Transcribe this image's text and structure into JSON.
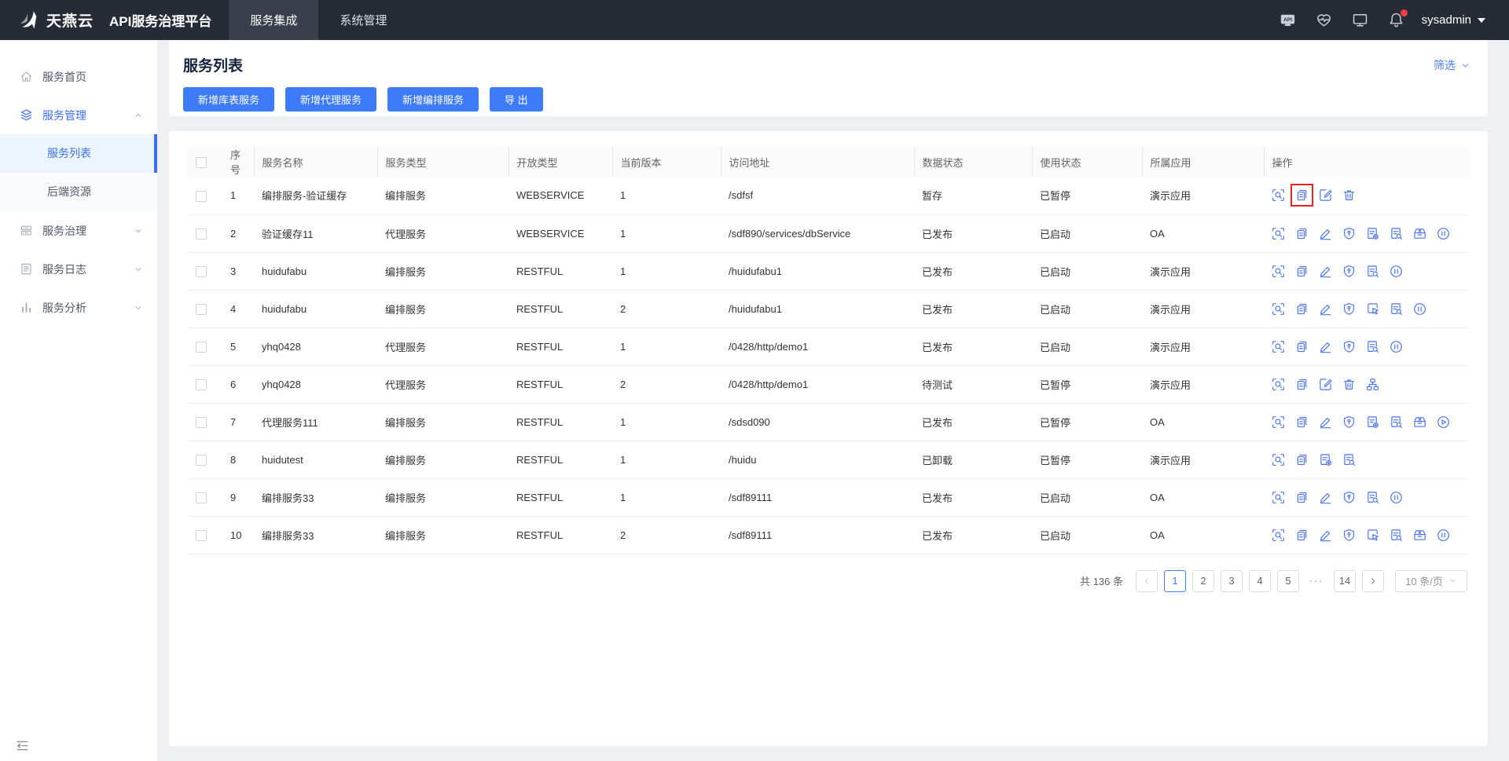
{
  "colors": {
    "accent": "#3e7bfa",
    "topbar_bg": "#272b35",
    "highlight_red": "#e8221c",
    "sidebar_active_bg": "#ecf4fe"
  },
  "topbar": {
    "logo_icon": "logo-icon",
    "brand": "天燕云",
    "product": "API服务治理平台",
    "tabs": [
      {
        "label": "服务集成",
        "active": true
      },
      {
        "label": "系统管理",
        "active": false
      }
    ],
    "icons": [
      {
        "name": "api-badge-icon"
      },
      {
        "name": "health-icon"
      },
      {
        "name": "monitor-icon"
      },
      {
        "name": "bell-icon",
        "badge": true
      }
    ],
    "user": "sysadmin"
  },
  "sidebar": {
    "items": [
      {
        "label": "服务首页",
        "icon": "home-icon"
      },
      {
        "label": "服务管理",
        "icon": "layers-icon",
        "active": true,
        "expanded": true,
        "children": [
          {
            "label": "服务列表",
            "selected": true
          },
          {
            "label": "后端资源",
            "selected": false
          }
        ]
      },
      {
        "label": "服务治理",
        "icon": "govern-icon",
        "collapsible": true
      },
      {
        "label": "服务日志",
        "icon": "log-icon",
        "collapsible": true
      },
      {
        "label": "服务分析",
        "icon": "chart-icon",
        "collapsible": true
      }
    ],
    "collapse_icon": "collapse-menu-icon"
  },
  "page": {
    "title": "服务列表",
    "filter_label": "筛选",
    "buttons": [
      {
        "label": "新增库表服务"
      },
      {
        "label": "新增代理服务"
      },
      {
        "label": "新增编排服务"
      },
      {
        "label": "导 出"
      }
    ]
  },
  "table": {
    "columns": [
      "",
      "序号",
      "服务名称",
      "服务类型",
      "开放类型",
      "当前版本",
      "访问地址",
      "数据状态",
      "使用状态",
      "所属应用",
      "操作"
    ],
    "rows": [
      {
        "index": "1",
        "name": "编排服务-验证缓存",
        "type": "编排服务",
        "open_type": "WEBSERVICE",
        "version": "1",
        "address": "/sdfsf",
        "data_status": "暂存",
        "use_status": "已暂停",
        "app": "演示应用",
        "ops": [
          {
            "icon": "view-icon"
          },
          {
            "icon": "copy-icon",
            "highlight": true
          },
          {
            "icon": "edit-square-icon"
          },
          {
            "icon": "trash-icon"
          }
        ]
      },
      {
        "index": "2",
        "name": "验证缓存11",
        "type": "代理服务",
        "open_type": "WEBSERVICE",
        "version": "1",
        "address": "/sdf890/services/dbService",
        "data_status": "已发布",
        "use_status": "已启动",
        "app": "OA",
        "ops": [
          {
            "icon": "view-icon"
          },
          {
            "icon": "copy-icon"
          },
          {
            "icon": "pencil-icon"
          },
          {
            "icon": "shield-icon"
          },
          {
            "icon": "doc-plus-icon"
          },
          {
            "icon": "doc-search-icon"
          },
          {
            "icon": "box-x-icon"
          },
          {
            "icon": "pause-icon"
          }
        ]
      },
      {
        "index": "3",
        "name": "huidufabu",
        "type": "编排服务",
        "open_type": "RESTFUL",
        "version": "1",
        "address": "/huidufabu1",
        "data_status": "已发布",
        "use_status": "已启动",
        "app": "演示应用",
        "ops": [
          {
            "icon": "view-icon"
          },
          {
            "icon": "copy-icon"
          },
          {
            "icon": "pencil-icon"
          },
          {
            "icon": "shield-icon"
          },
          {
            "icon": "doc-search-icon"
          },
          {
            "icon": "pause-icon"
          }
        ]
      },
      {
        "index": "4",
        "name": "huidufabu",
        "type": "编排服务",
        "open_type": "RESTFUL",
        "version": "2",
        "address": "/huidufabu1",
        "data_status": "已发布",
        "use_status": "已启动",
        "app": "演示应用",
        "ops": [
          {
            "icon": "view-icon"
          },
          {
            "icon": "copy-icon"
          },
          {
            "icon": "pencil-icon"
          },
          {
            "icon": "shield-icon"
          },
          {
            "icon": "doc-cursor-icon"
          },
          {
            "icon": "doc-search-icon"
          },
          {
            "icon": "pause-icon"
          }
        ]
      },
      {
        "index": "5",
        "name": "yhq0428",
        "type": "代理服务",
        "open_type": "RESTFUL",
        "version": "1",
        "address": "/0428/http/demo1",
        "data_status": "已发布",
        "use_status": "已启动",
        "app": "演示应用",
        "ops": [
          {
            "icon": "view-icon"
          },
          {
            "icon": "copy-icon"
          },
          {
            "icon": "pencil-icon"
          },
          {
            "icon": "shield-icon"
          },
          {
            "icon": "doc-search-icon"
          },
          {
            "icon": "pause-icon"
          }
        ]
      },
      {
        "index": "6",
        "name": "yhq0428",
        "type": "代理服务",
        "open_type": "RESTFUL",
        "version": "2",
        "address": "/0428/http/demo1",
        "data_status": "待测试",
        "use_status": "已暂停",
        "app": "演示应用",
        "ops": [
          {
            "icon": "view-icon"
          },
          {
            "icon": "copy-icon"
          },
          {
            "icon": "edit-square-icon"
          },
          {
            "icon": "trash-icon"
          },
          {
            "icon": "sitemap-icon"
          }
        ]
      },
      {
        "index": "7",
        "name": "代理服务111",
        "type": "编排服务",
        "open_type": "RESTFUL",
        "version": "1",
        "address": "/sdsd090",
        "data_status": "已发布",
        "use_status": "已暂停",
        "app": "OA",
        "ops": [
          {
            "icon": "view-icon"
          },
          {
            "icon": "copy-icon"
          },
          {
            "icon": "pencil-icon"
          },
          {
            "icon": "shield-icon"
          },
          {
            "icon": "doc-plus-icon"
          },
          {
            "icon": "doc-search-icon"
          },
          {
            "icon": "box-x-icon"
          },
          {
            "icon": "play-icon"
          }
        ]
      },
      {
        "index": "8",
        "name": "huidutest",
        "type": "编排服务",
        "open_type": "RESTFUL",
        "version": "1",
        "address": "/huidu",
        "data_status": "已卸载",
        "use_status": "已暂停",
        "app": "演示应用",
        "ops": [
          {
            "icon": "view-icon"
          },
          {
            "icon": "copy-icon"
          },
          {
            "icon": "doc-plus-icon"
          },
          {
            "icon": "doc-search-icon"
          }
        ]
      },
      {
        "index": "9",
        "name": "编排服务33",
        "type": "编排服务",
        "open_type": "RESTFUL",
        "version": "1",
        "address": "/sdf89111",
        "data_status": "已发布",
        "use_status": "已启动",
        "app": "OA",
        "ops": [
          {
            "icon": "view-icon"
          },
          {
            "icon": "copy-icon"
          },
          {
            "icon": "pencil-icon"
          },
          {
            "icon": "shield-icon"
          },
          {
            "icon": "doc-search-icon"
          },
          {
            "icon": "pause-icon"
          }
        ]
      },
      {
        "index": "10",
        "name": "编排服务33",
        "type": "编排服务",
        "open_type": "RESTFUL",
        "version": "2",
        "address": "/sdf89111",
        "data_status": "已发布",
        "use_status": "已启动",
        "app": "OA",
        "ops": [
          {
            "icon": "view-icon"
          },
          {
            "icon": "copy-icon"
          },
          {
            "icon": "pencil-icon"
          },
          {
            "icon": "shield-icon"
          },
          {
            "icon": "doc-cursor-icon"
          },
          {
            "icon": "doc-search-icon"
          },
          {
            "icon": "box-x-icon"
          },
          {
            "icon": "pause-icon"
          }
        ]
      }
    ]
  },
  "pagination": {
    "total_label": "共 136 条",
    "prev_icon": "chevron-left-icon",
    "next_icon": "chevron-right-icon",
    "pages": [
      {
        "label": "1",
        "active": true
      },
      {
        "label": "2"
      },
      {
        "label": "3"
      },
      {
        "label": "4"
      },
      {
        "label": "5"
      },
      {
        "label": "···",
        "ellipsis": true
      },
      {
        "label": "14"
      }
    ],
    "page_size": "10 条/页"
  }
}
